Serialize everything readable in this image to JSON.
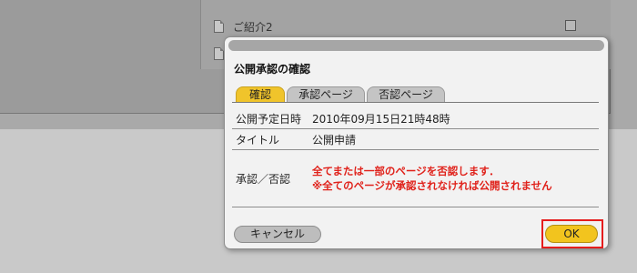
{
  "background": {
    "list_item_label": "ご紹介2"
  },
  "dialog": {
    "title": "公開承認の確認",
    "tabs": [
      {
        "label": "確認",
        "active": true
      },
      {
        "label": "承認ページ",
        "active": false
      },
      {
        "label": "否認ページ",
        "active": false
      }
    ],
    "rows": {
      "publish_date_label": "公開予定日時",
      "publish_date_value": "2010年09月15日21時48時",
      "title_label": "タイトル",
      "title_value": "公開申請",
      "approve_label": "承認／否認",
      "approve_message_line1": "全てまたは一部のページを否認します．",
      "approve_message_line2": "※全てのページが承認されなければ公開されません"
    },
    "buttons": {
      "cancel_label": "キャンセル",
      "ok_label": "OK"
    }
  },
  "colors": {
    "active_tab": "#f0c42b",
    "ok_button": "#f2c41e",
    "highlight_frame": "#e51d1d",
    "warning_text": "#e0221b"
  }
}
